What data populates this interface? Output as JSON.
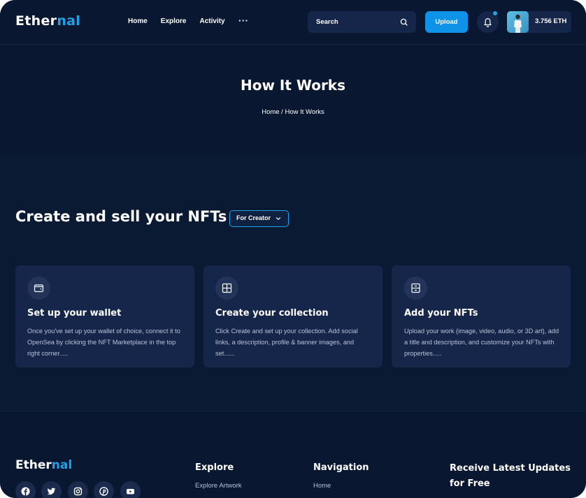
{
  "brand": {
    "name_main": "Ether",
    "name_accent": "nal",
    "accent_color": "#1ea2ea"
  },
  "header": {
    "nav": [
      "Home",
      "Explore",
      "Activity"
    ],
    "more": "···",
    "search_placeholder": "Search",
    "upload_label": "Upload",
    "balance": "3.756 ETH"
  },
  "hero": {
    "title": "How It Works",
    "breadcrumb": "Home / How It Works"
  },
  "section": {
    "title": "Create and sell your NFTs",
    "dropdown_value": "For Creator"
  },
  "cards": [
    {
      "icon": "wallet-icon",
      "title": "Set up your wallet",
      "description": "Once you've set up your wallet of choice, connect it to OpenSea by clicking the NFT Marketplace in the top right corner....."
    },
    {
      "icon": "grid-icon",
      "title": "Create your collection",
      "description": "Click Create and set up your collection. Add social links, a description, profile & banner images, and set......"
    },
    {
      "icon": "archive-icon",
      "title": "Add your NFTs",
      "description": "Upload your work (image, video, audio, or 3D art), add a title and description, and customize your NFTs with properties....."
    }
  ],
  "footer": {
    "social_icons": [
      "facebook-icon",
      "twitter-icon",
      "instagram-icon",
      "pinterest-icon",
      "youtube-icon"
    ],
    "explore_heading": "Explore",
    "explore_links": [
      "Explore Artwork"
    ],
    "navigation_heading": "Navigation",
    "navigation_links": [
      "Home"
    ],
    "newsletter_heading": "Receive Latest Updates for Free"
  },
  "colors": {
    "background": "#0b1a33",
    "card": "#16264a",
    "primary": "#0f93e8"
  }
}
